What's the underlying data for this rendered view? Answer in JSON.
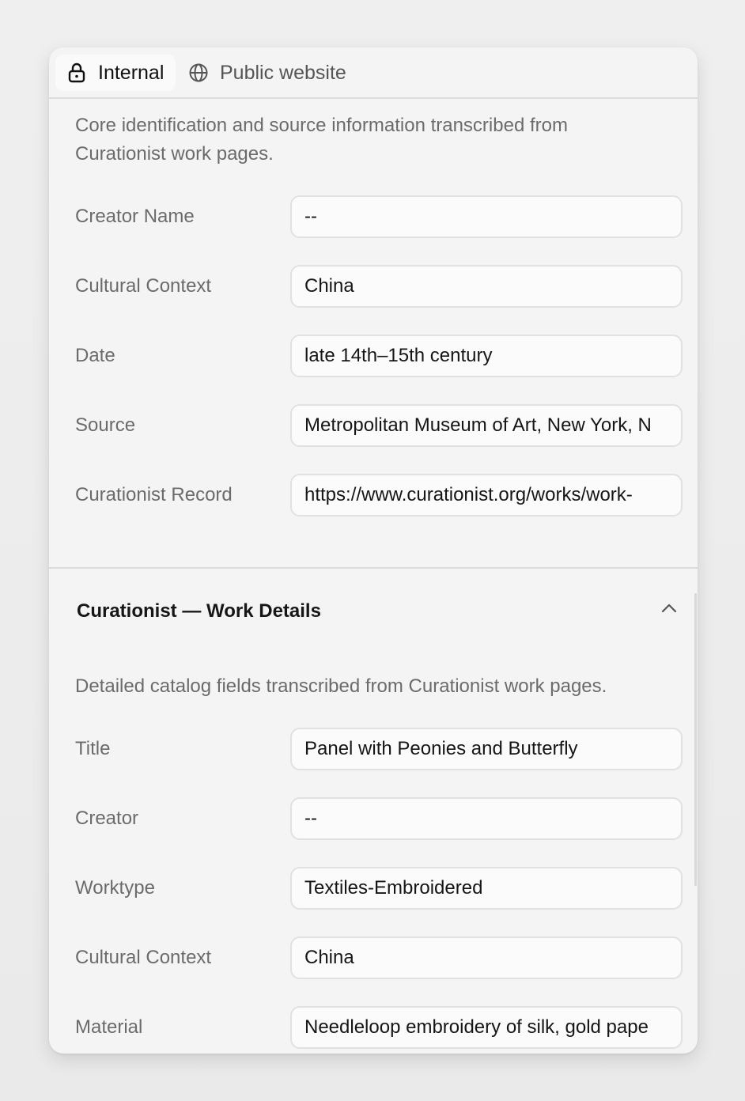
{
  "tabs": [
    {
      "label": "Internal",
      "icon": "lock-icon",
      "active": true
    },
    {
      "label": "Public website",
      "icon": "globe-icon",
      "active": false
    }
  ],
  "section1": {
    "description_line1": "Core identification and source information transcribed from",
    "description_line2": "Curationist work pages.",
    "fields": [
      {
        "label": "Creator Name",
        "value": "--"
      },
      {
        "label": "Cultural Context",
        "value": "China"
      },
      {
        "label": "Date",
        "value": "late 14th–15th century"
      },
      {
        "label": "Source",
        "value": "Metropolitan Museum of Art, New York, N"
      },
      {
        "label": "Curationist Record",
        "value": "https://www.curationist.org/works/work-"
      }
    ]
  },
  "section2": {
    "title": "Curationist — Work Details",
    "toggle_icon": "chevron-up-icon",
    "description": "Detailed catalog fields transcribed from Curationist work pages.",
    "fields": [
      {
        "label": "Title",
        "value": "Panel with Peonies and Butterfly"
      },
      {
        "label": "Creator",
        "value": "--"
      },
      {
        "label": "Worktype",
        "value": "Textiles-Embroidered"
      },
      {
        "label": "Cultural Context",
        "value": "China"
      },
      {
        "label": "Material",
        "value": "Needleloop embroidery of silk, gold pape"
      }
    ]
  }
}
